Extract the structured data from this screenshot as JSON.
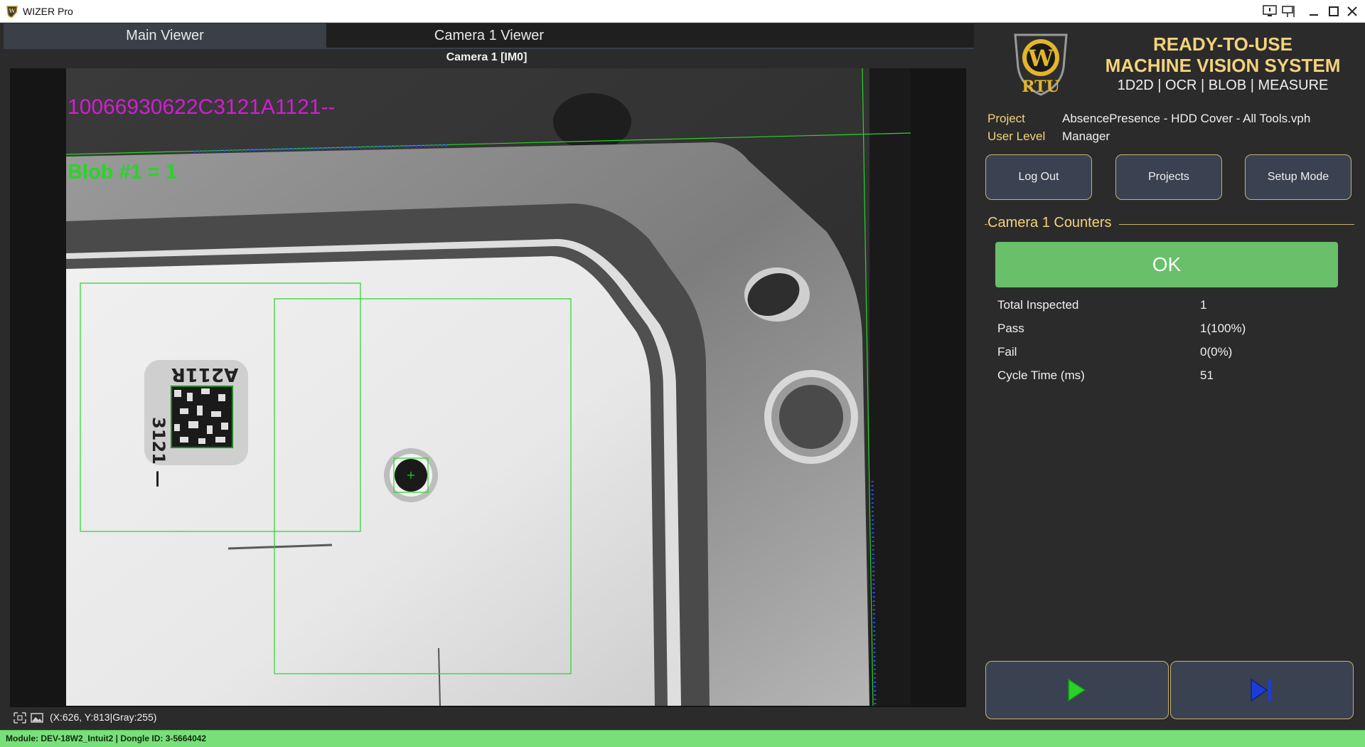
{
  "window": {
    "title": "WIZER Pro"
  },
  "tabs": [
    {
      "label": "Main Viewer",
      "active": true
    },
    {
      "label": "Camera 1 Viewer",
      "active": false
    }
  ],
  "viewer": {
    "title": "Camera 1  [IM0]",
    "ocr_result": "10066930622C3121A1121--",
    "blob_result": "Blob #1 = 1",
    "coordinates": "(X:626, Y:813|Gray:255)"
  },
  "module_bar": {
    "text": "Module: DEV-18W2_Intuit2 | Dongle ID: 3-5664042"
  },
  "brand": {
    "logo_letters": "RTU",
    "headline_line1": "READY-TO-USE",
    "headline_line2": "MACHINE VISION SYSTEM",
    "tools_line": "1D2D | OCR | BLOB | MEASURE"
  },
  "info": {
    "project_label": "Project",
    "project_value": "AbsencePresence - HDD Cover - All Tools.vph",
    "user_level_label": "User Level",
    "user_level_value": "Manager"
  },
  "buttons": {
    "log_out": "Log Out",
    "projects": "Projects",
    "setup_mode": "Setup Mode"
  },
  "counters": {
    "section_title": "Camera 1 Counters",
    "status": "OK",
    "rows": [
      {
        "label": "Total Inspected",
        "value": "1"
      },
      {
        "label": "Pass",
        "value": "1(100%)"
      },
      {
        "label": "Fail",
        "value": "0(0%)"
      },
      {
        "label": "Cycle Time (ms)",
        "value": "51"
      }
    ]
  },
  "colors": {
    "accent_gold": "#c8b26e",
    "ok_green": "#6abf6a",
    "ocr_magenta": "#d31dd3",
    "overlay_green": "#26d626",
    "module_bar_green": "#79e079",
    "play_green": "#27d327",
    "step_blue": "#1b3cd9"
  },
  "icons": {
    "app": "wizer-app-icon",
    "play": "play-icon",
    "step": "step-forward-icon"
  }
}
